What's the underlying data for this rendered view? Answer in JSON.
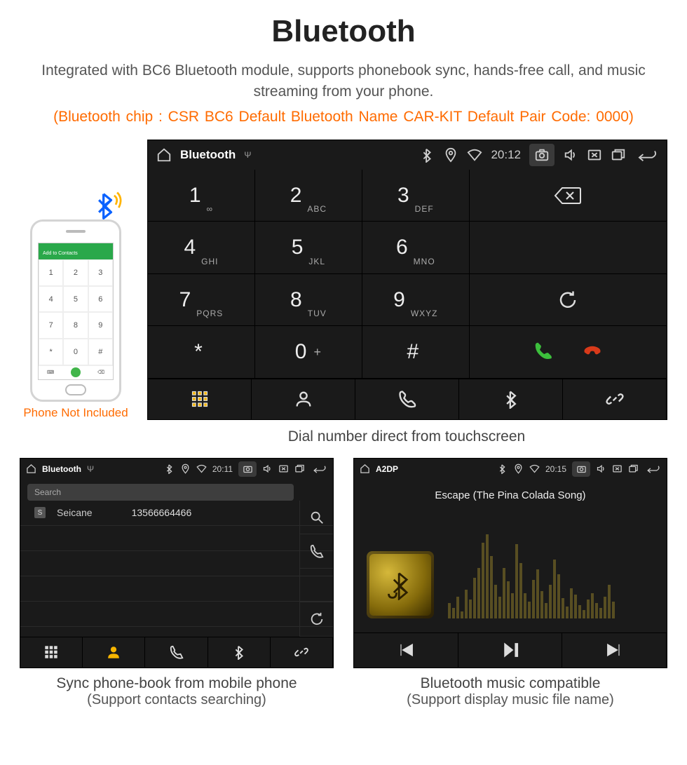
{
  "heading": "Bluetooth",
  "subtitle": "Integrated with BC6 Bluetooth module, supports phonebook sync, hands-free call, and music streaming from your phone.",
  "orange_spec": "(Bluetooth chip : CSR BC6     Default Bluetooth Name CAR-KIT    Default Pair Code: 0000)",
  "phone_note": "Phone Not Included",
  "phone_mock": {
    "add_contacts": "Add to Contacts"
  },
  "main_shell": {
    "title": "Bluetooth",
    "time": "20:12",
    "keys": [
      {
        "num": "1",
        "sub": "∞"
      },
      {
        "num": "2",
        "sub": "ABC"
      },
      {
        "num": "3",
        "sub": "DEF"
      },
      {
        "num": "4",
        "sub": "GHI"
      },
      {
        "num": "5",
        "sub": "JKL"
      },
      {
        "num": "6",
        "sub": "MNO"
      },
      {
        "num": "7",
        "sub": "PQRS"
      },
      {
        "num": "8",
        "sub": "TUV"
      },
      {
        "num": "9",
        "sub": "WXYZ"
      },
      {
        "num": "*",
        "sub": ""
      },
      {
        "num": "0",
        "sub": "+"
      },
      {
        "num": "#",
        "sub": ""
      }
    ]
  },
  "caption_main": "Dial number direct from touchscreen",
  "pb_shell": {
    "title": "Bluetooth",
    "time": "20:11",
    "search_placeholder": "Search",
    "contact_tag": "S",
    "contact_name": "Seicane",
    "contact_number": "13566664466"
  },
  "caption_pb_line1": "Sync phone-book from mobile phone",
  "caption_pb_line2": "(Support contacts searching)",
  "music_shell": {
    "title": "A2DP",
    "time": "20:15",
    "song": "Escape (The Pina Colada Song)"
  },
  "caption_music_line1": "Bluetooth music compatible",
  "caption_music_line2": "(Support display music file name)"
}
